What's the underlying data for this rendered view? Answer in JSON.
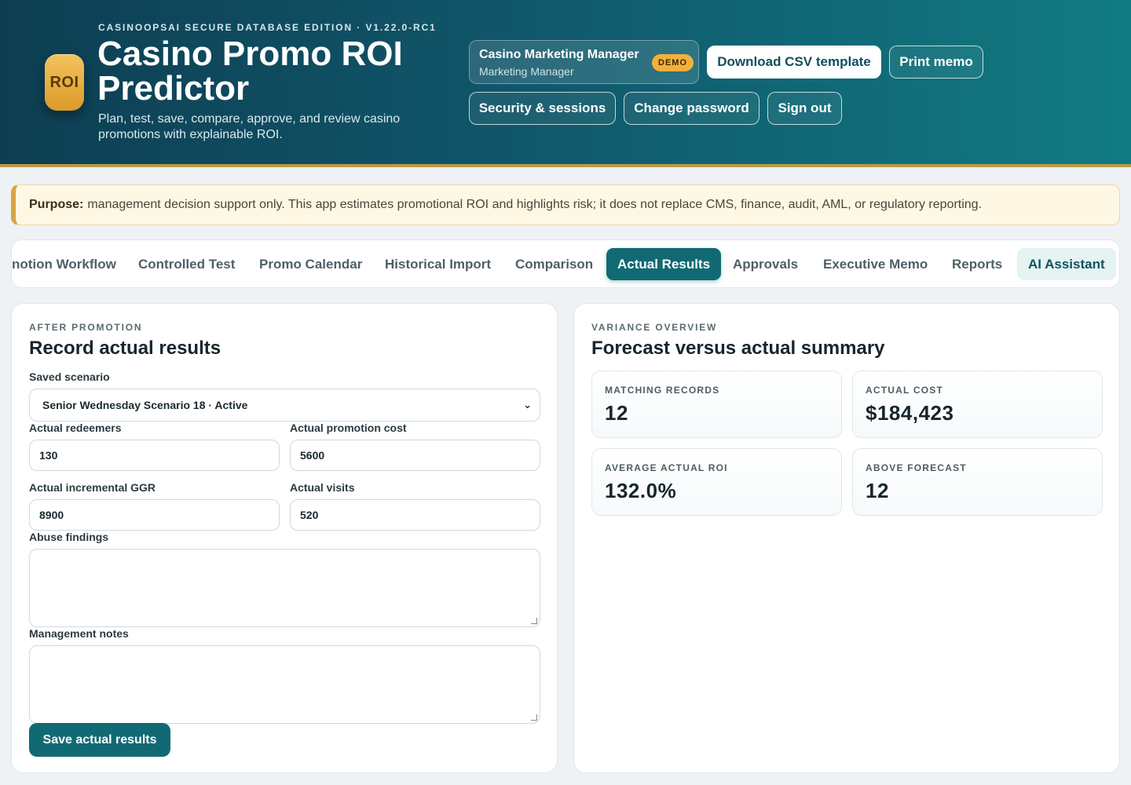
{
  "header": {
    "edition": "CASINOOPSAI SECURE DATABASE EDITION · V1.22.0-RC1",
    "logo_text": "ROI",
    "title": "Casino Promo ROI Predictor",
    "subtitle": "Plan, test, save, compare, approve, and review casino promotions with explainable ROI.",
    "user": {
      "name": "Casino Marketing Manager",
      "role": "Marketing Manager",
      "badge": "DEMO"
    },
    "buttons": {
      "download_csv": "Download CSV template",
      "print_memo": "Print memo",
      "security": "Security & sessions",
      "change_password": "Change password",
      "sign_out": "Sign out"
    }
  },
  "purpose": {
    "label": "Purpose:",
    "text": "management decision support only. This app estimates promotional ROI and highlights risk; it does not replace CMS, finance, audit, AML, or regulatory reporting."
  },
  "tabs": [
    {
      "label": "notion Workflow"
    },
    {
      "label": "Controlled Test"
    },
    {
      "label": "Promo Calendar"
    },
    {
      "label": "Historical Import"
    },
    {
      "label": "Comparison"
    },
    {
      "label": "Actual Results"
    },
    {
      "label": "Approvals"
    },
    {
      "label": "Executive Memo"
    },
    {
      "label": "Reports"
    },
    {
      "label": "AI Assistant"
    }
  ],
  "record_panel": {
    "eyebrow": "AFTER PROMOTION",
    "title": "Record actual results",
    "saved_scenario_label": "Saved scenario",
    "saved_scenario_value": "Senior Wednesday Scenario 18 · Active",
    "fields": {
      "redeemers": {
        "label": "Actual redeemers",
        "value": "130"
      },
      "cost": {
        "label": "Actual promotion cost",
        "value": "5600"
      },
      "ggr": {
        "label": "Actual incremental GGR",
        "value": "8900"
      },
      "visits": {
        "label": "Actual visits",
        "value": "520"
      }
    },
    "abuse_label": "Abuse findings",
    "notes_label": "Management notes",
    "save_button": "Save actual results"
  },
  "variance_panel": {
    "eyebrow": "VARIANCE OVERVIEW",
    "title": "Forecast versus actual summary",
    "stats": [
      {
        "label": "MATCHING RECORDS",
        "value": "12"
      },
      {
        "label": "ACTUAL COST",
        "value": "$184,423"
      },
      {
        "label": "AVERAGE ACTUAL ROI",
        "value": "132.0%"
      },
      {
        "label": "ABOVE FORECAST",
        "value": "12"
      }
    ]
  }
}
